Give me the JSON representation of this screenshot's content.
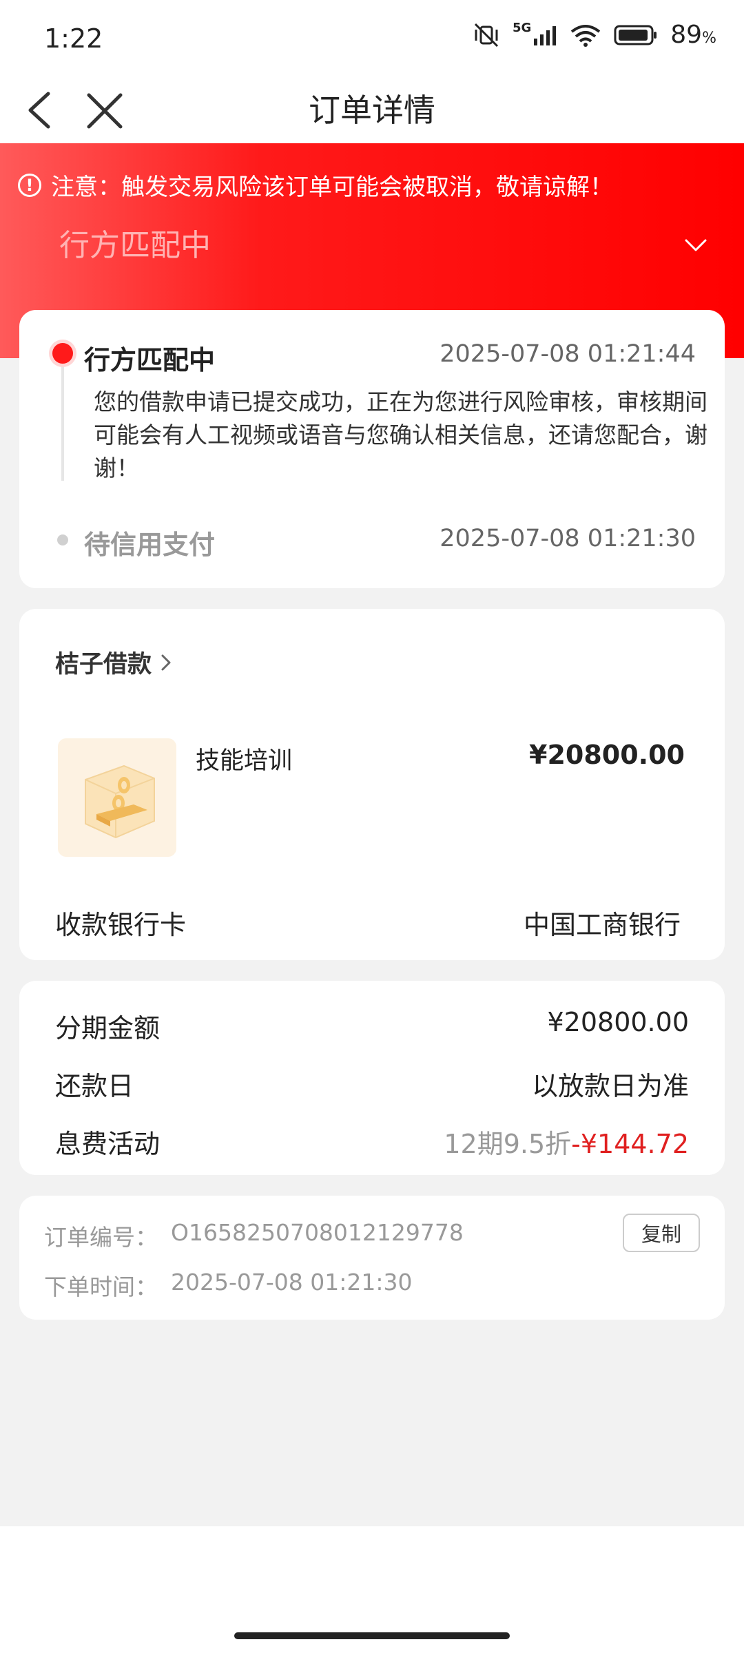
{
  "status_bar": {
    "time": "1:22",
    "network": "5G",
    "battery": "89",
    "battery_unit": "%"
  },
  "nav": {
    "title": "订单详情"
  },
  "banner": {
    "warning": "注意：触发交易风险该订单可能会被取消，敬请谅解！",
    "status": "行方匹配中",
    "colors": {
      "start": "#ff5a5a",
      "end": "#ff0000"
    }
  },
  "timeline": {
    "steps": [
      {
        "title": "行方匹配中",
        "time": "2025-07-08 01:21:44",
        "desc": "您的借款申请已提交成功，正在为您进行风险审核，审核期间可能会有人工视频或语音与您确认相关信息，还请您配合，谢谢！"
      },
      {
        "title": "待信用支付",
        "time": "2025-07-08 01:21:30"
      }
    ]
  },
  "product": {
    "merchant": "桔子借款",
    "name": "技能培训",
    "price": "¥20800.00",
    "image_icon": "gold-coins-box-icon",
    "bank_label": "收款银行卡",
    "bank_value": "中国工商银行"
  },
  "installment": {
    "amount_label": "分期金额",
    "amount_value": "¥20800.00",
    "repay_label": "还款日",
    "repay_value": "以放款日为准",
    "fee_label": "息费活动",
    "fee_plan": "12期9.5折",
    "fee_discount": "-¥144.72"
  },
  "order_info": {
    "number_label": "订单编号：",
    "number_value": "O1658250708012129778",
    "time_label": "下单时间：",
    "time_value": "2025-07-08 01:21:30",
    "copy_label": "复制"
  },
  "colors": {
    "accent": "#ff1a1a",
    "price_red": "#e02020"
  }
}
